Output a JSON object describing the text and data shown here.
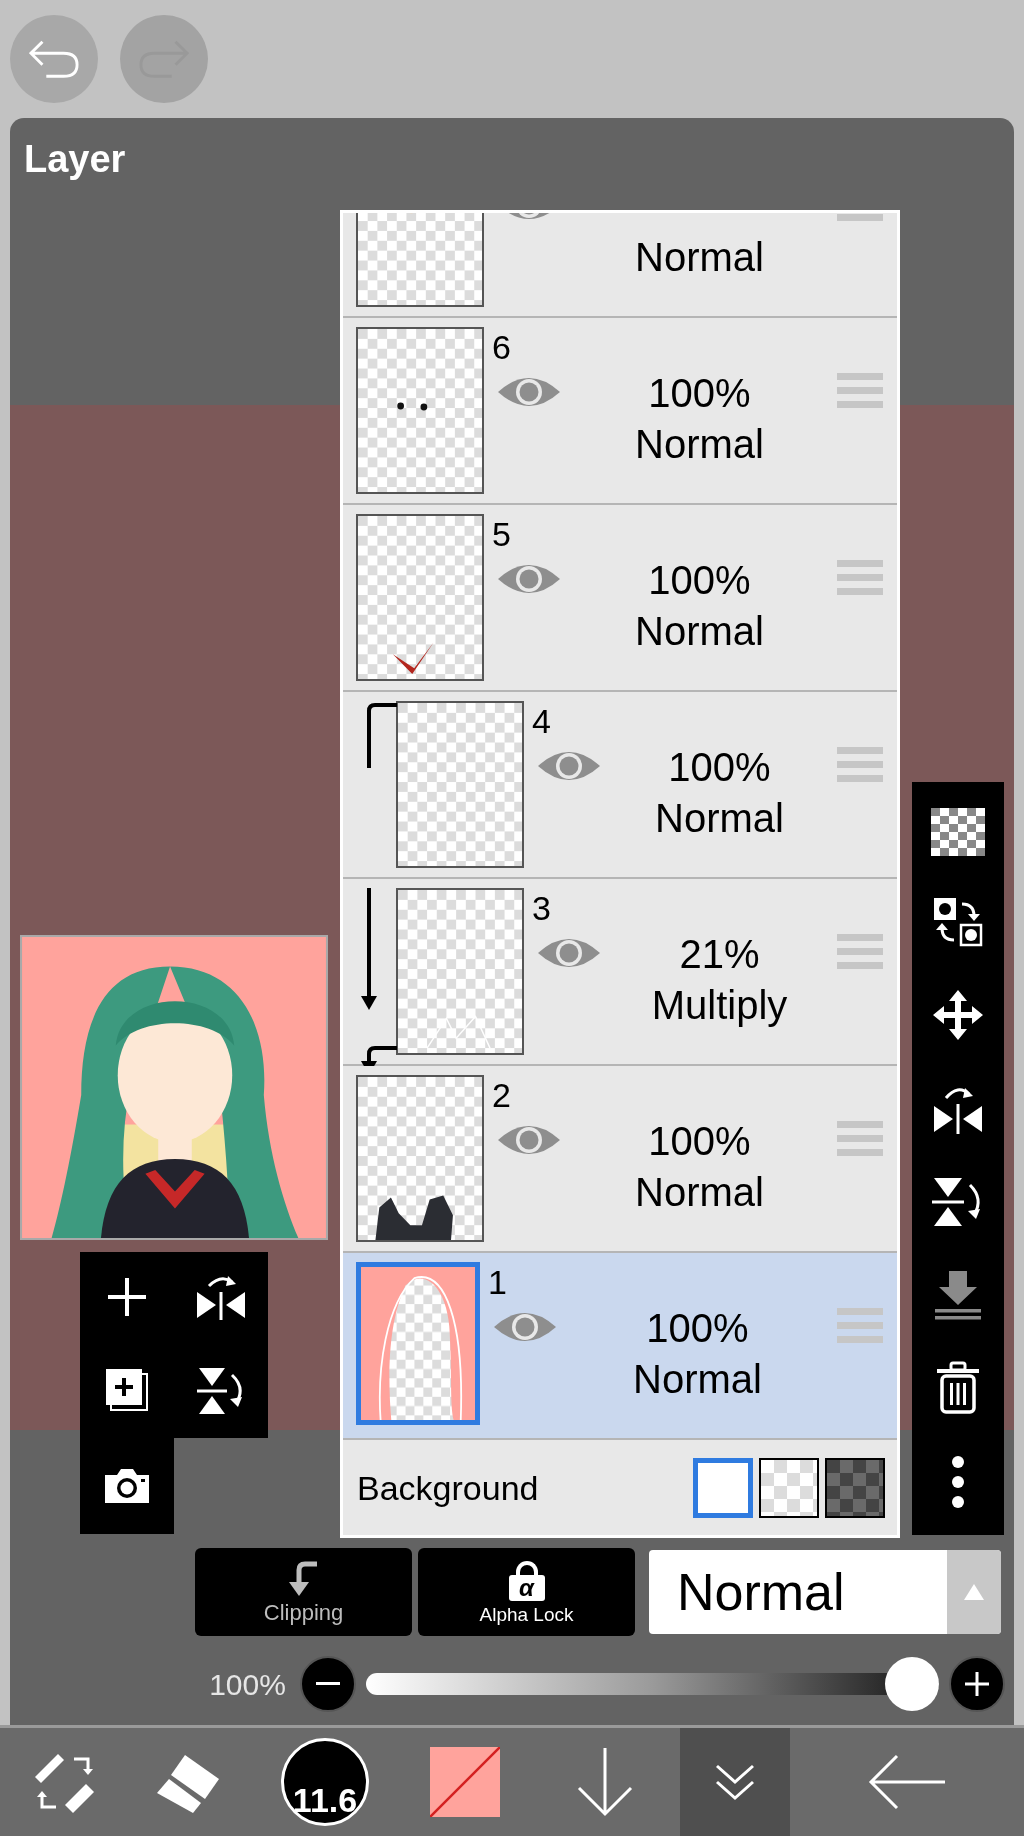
{
  "undo": {
    "disabled": false
  },
  "redo": {
    "disabled": true
  },
  "panel": {
    "title": "Layer"
  },
  "layers": [
    {
      "blend": "Normal",
      "visible": true,
      "clipped": false,
      "selected": false
    },
    {
      "number": "6",
      "opacity": "100%",
      "blend": "Normal",
      "visible": true,
      "clipped": false,
      "selected": false
    },
    {
      "number": "5",
      "opacity": "100%",
      "blend": "Normal",
      "visible": true,
      "clipped": false,
      "selected": false
    },
    {
      "number": "4",
      "opacity": "100%",
      "blend": "Normal",
      "visible": true,
      "clipped": true,
      "selected": false
    },
    {
      "number": "3",
      "opacity": "21%",
      "blend": "Multiply",
      "visible": true,
      "clipped": true,
      "selected": false
    },
    {
      "number": "2",
      "opacity": "100%",
      "blend": "Normal",
      "visible": true,
      "clipped": false,
      "selected": false
    },
    {
      "number": "1",
      "opacity": "100%",
      "blend": "Normal",
      "visible": true,
      "clipped": false,
      "selected": true
    }
  ],
  "background": {
    "label": "Background",
    "options": [
      {
        "kind": "white",
        "selected": true
      },
      {
        "kind": "transparent",
        "selected": false
      },
      {
        "kind": "dark",
        "selected": false
      }
    ]
  },
  "merge_down": {
    "disabled": true
  },
  "clipping": {
    "label": "Clipping",
    "disabled": true
  },
  "alpha_lock": {
    "label": "Alpha Lock",
    "glyph": "α",
    "disabled": false
  },
  "blend_mode": {
    "value": "Normal"
  },
  "opacity": {
    "reading": "100%",
    "level": 1
  },
  "brush_size": "11.6"
}
